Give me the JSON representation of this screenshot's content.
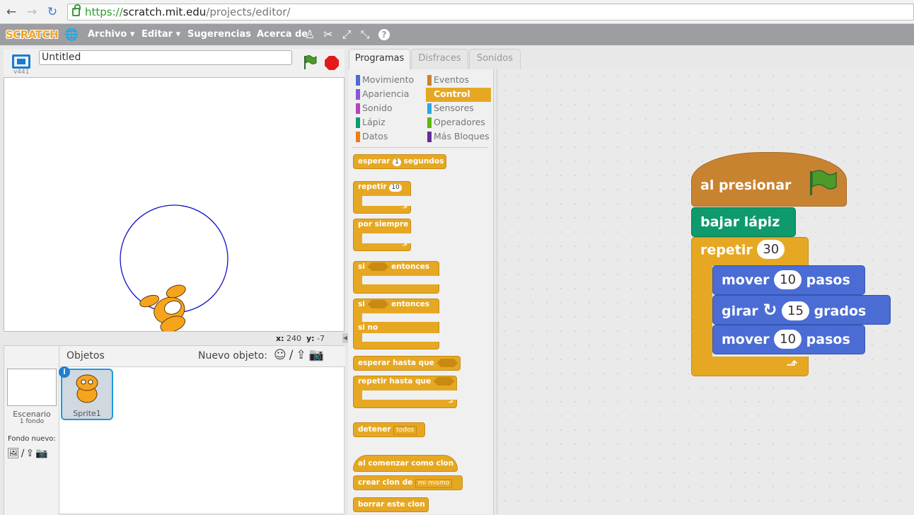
{
  "browser": {
    "url_scheme": "https://",
    "url_host": "scratch.mit.edu",
    "url_path": "/projects/editor/"
  },
  "menubar": {
    "logo": "SCRATCH",
    "items": [
      "Archivo ▾",
      "Editar ▾",
      "Sugerencias",
      "Acerca de"
    ]
  },
  "stage": {
    "version": "v441",
    "project_title": "Untitled",
    "coords_x_label": "x:",
    "coords_x": "240",
    "coords_y_label": "y:",
    "coords_y": "-7"
  },
  "sprites": {
    "objects_label": "Objetos",
    "new_object_label": "Nuevo objeto:",
    "stage_label": "Escenario",
    "stage_backdrops": "1 fondo",
    "new_backdrop_label": "Fondo nuevo:",
    "sprite_name": "Sprite1",
    "info_icon": "i"
  },
  "tabs": [
    "Programas",
    "Disfraces",
    "Sonidos"
  ],
  "categories": [
    {
      "label": "Movimiento",
      "color": "#4a6cd4"
    },
    {
      "label": "Eventos",
      "color": "#c88330"
    },
    {
      "label": "Apariencia",
      "color": "#8a55d7"
    },
    {
      "label": "Control",
      "color": "#e6a823"
    },
    {
      "label": "Sonido",
      "color": "#bb42c3"
    },
    {
      "label": "Sensores",
      "color": "#2ca5e2"
    },
    {
      "label": "Lápiz",
      "color": "#0e9a6c"
    },
    {
      "label": "Operadores",
      "color": "#5cb712"
    },
    {
      "label": "Datos",
      "color": "#ee7d16"
    },
    {
      "label": "Más Bloques",
      "color": "#632d99"
    }
  ],
  "palette": {
    "wait": "esperar",
    "wait_val": "1",
    "wait_unit": "segundos",
    "repeat": "repetir",
    "repeat_val": "10",
    "forever": "por siempre",
    "if": "si",
    "then": "entonces",
    "else": "si no",
    "wait_until": "esperar hasta que",
    "repeat_until": "repetir hasta que",
    "stop": "detener",
    "stop_val": "todos",
    "when_clone": "al comenzar como clon",
    "create_clone": "crear clon de",
    "create_clone_val": "mi mismo",
    "delete_clone": "borrar este clon"
  },
  "script": {
    "hat": "al presionar",
    "pen_down": "bajar lápiz",
    "repeat": "repetir",
    "repeat_val": "30",
    "move1": "mover",
    "move1_val": "10",
    "steps": "pasos",
    "turn": "girar",
    "turn_val": "15",
    "degrees": "grados",
    "move2": "mover",
    "move2_val": "10"
  },
  "colors": {
    "control": "#e6a823",
    "events": "#c88330",
    "pen": "#0e9a6c",
    "motion": "#4a6cd4"
  }
}
